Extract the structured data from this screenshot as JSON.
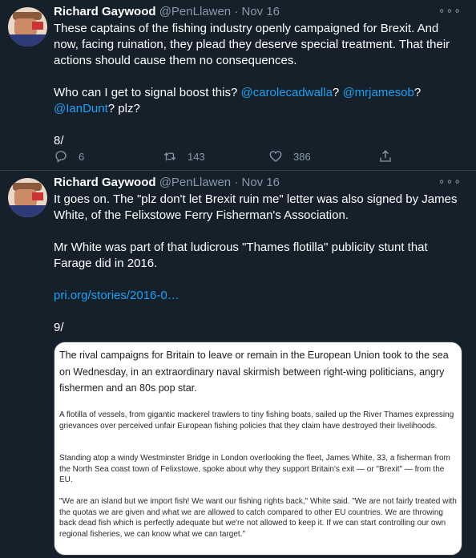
{
  "tweets": [
    {
      "name": "Richard Gaywood",
      "handle": "@PenLlawen",
      "dot": "·",
      "date": "Nov 16",
      "more": "∘∘∘",
      "text1": "These captains of the fishing industry openly campaigned for Brexit. And now, facing ruination, they plead they deserve special treatment. That their actions should cause them no consequences.",
      "text2a": "Who can I get to signal boost this? ",
      "mention1": "@carolecadwalla",
      "sep1": "? ",
      "mention2": "@mrjamesob",
      "sep2": "?",
      "mention3": "@IanDunt",
      "text2b": "? plz?",
      "counter": "8/",
      "actions": {
        "replies": "6",
        "retweets": "143",
        "likes": "386"
      }
    },
    {
      "name": "Richard Gaywood",
      "handle": "@PenLlawen",
      "dot": "·",
      "date": "Nov 16",
      "more": "∘∘∘",
      "text1": "It goes on. The \"plz don't let Brexit ruin me\" letter was also signed by James White, of the Felixstowe Ferry Fisherman's Association.",
      "text2": "Mr White was part of that ludicrous \"Thames flotilla\" publicity stunt that Farage did in 2016.",
      "link": "pri.org/stories/2016-0…",
      "counter": "9/",
      "quote": {
        "lead": "The rival campaigns for Britain to leave or remain in the European Union took to the sea on Wednesday, in an extraordinary naval skirmish between right-wing politicians, angry fishermen and an 80s pop star.",
        "p1": "A flotilla of vessels, from gigantic mackerel trawlers to tiny fishing boats, sailed up the River Thames expressing grievances over perceived unfair European fishing policies that they claim have destroyed their livelihoods.",
        "p2": "Standing atop a windy Westminster Bridge in London overlooking the fleet, James White, 33, a fisherman from the North Sea coast town of Felixstowe, spoke about why they support Britain's exit — or \"Brexit\" — from the EU.",
        "p3": "\"We are an island but we import fish! We want our fishing rights back,\" White said. \"We are not fairly treated with the quotas we are given and what we are allowed to catch compared to other EU countries. We are throwing back dead fish which is perfectly adequate but we're not allowed to keep it. If we can start controlling our own regional fisheries, we can know what we can target.\""
      }
    }
  ],
  "icons": {
    "reply": "reply-icon",
    "retweet": "retweet-icon",
    "like": "heart-icon",
    "share": "share-icon",
    "more": "more-icon"
  },
  "colors": {
    "background": "#15202b",
    "text": "#ffffff",
    "muted": "#8899a6",
    "accent": "#1da1f2",
    "divider": "#38444d"
  }
}
